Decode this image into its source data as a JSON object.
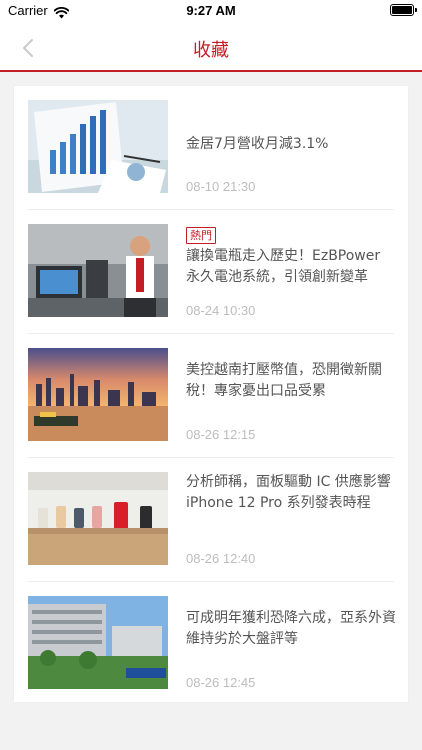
{
  "status_bar": {
    "carrier": "Carrier",
    "time": "9:27 AM"
  },
  "nav": {
    "title": "收藏",
    "back_icon": "chevron-left-icon"
  },
  "colors": {
    "accent": "#c41e24",
    "time_text": "#bdbdbd",
    "title_text": "#555555"
  },
  "articles": [
    {
      "badge": "",
      "title": "金居7月營收月減3.1%",
      "time": "08-10 21:30",
      "thumbnail": "business-chart-papers"
    },
    {
      "badge": "熱門",
      "title": "讓換電瓶走入歷史！EzBPower 永久電池系統，引領創新變革",
      "time": "08-24 10:30",
      "thumbnail": "man-with-battery-equipment"
    },
    {
      "badge": "",
      "title": "美控越南打壓幣值，恐開徵新關稅！專家憂出口品受累",
      "time": "08-26 12:15",
      "thumbnail": "city-skyline-river-sunset"
    },
    {
      "badge": "",
      "title": "分析師稱，面板驅動 IC 供應影響 iPhone 12 Pro 系列發表時程",
      "time": "08-26 12:40",
      "thumbnail": "phone-store-display"
    },
    {
      "badge": "",
      "title": "可成明年獲利恐降六成，亞系外資維持劣於大盤評等",
      "time": "08-26 12:45",
      "thumbnail": "company-building"
    }
  ]
}
